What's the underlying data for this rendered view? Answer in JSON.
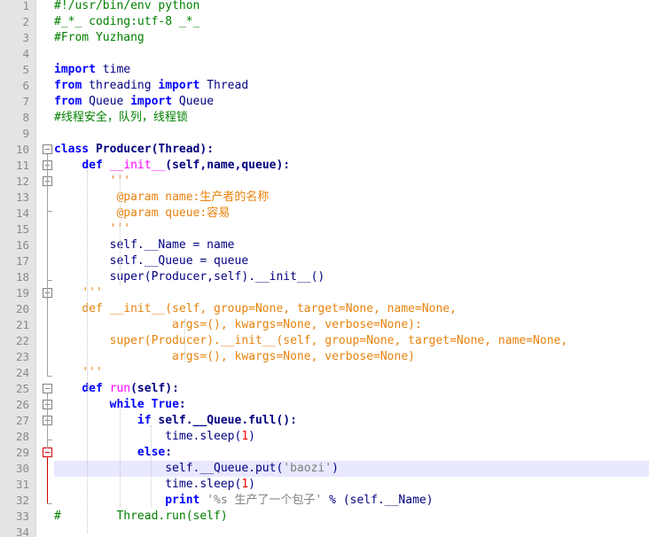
{
  "lines": [
    {
      "n": "1",
      "segs": [
        [
          "c",
          "#!/usr/bin/env python"
        ]
      ]
    },
    {
      "n": "2",
      "segs": [
        [
          "c",
          "#_*_ coding:utf-8 _*_"
        ]
      ]
    },
    {
      "n": "3",
      "segs": [
        [
          "c",
          "#From Yuzhang"
        ]
      ]
    },
    {
      "n": "4",
      "segs": []
    },
    {
      "n": "5",
      "segs": [
        [
          "k",
          "import"
        ],
        [
          "t",
          " time"
        ]
      ]
    },
    {
      "n": "6",
      "segs": [
        [
          "k",
          "from"
        ],
        [
          "t",
          " threading "
        ],
        [
          "k",
          "import"
        ],
        [
          "t",
          " Thread"
        ]
      ]
    },
    {
      "n": "7",
      "segs": [
        [
          "k",
          "from"
        ],
        [
          "t",
          " Queue "
        ],
        [
          "k",
          "import"
        ],
        [
          "t",
          " Queue"
        ]
      ]
    },
    {
      "n": "8",
      "segs": [
        [
          "c",
          "#线程安全，队列，线程锁"
        ]
      ]
    },
    {
      "n": "9",
      "segs": []
    },
    {
      "n": "10",
      "segs": [
        [
          "k",
          "class"
        ],
        [
          "b",
          " Producer"
        ],
        [
          "b",
          "(Thread):"
        ]
      ]
    },
    {
      "n": "11",
      "segs": [
        [
          "t",
          "    "
        ],
        [
          "k",
          "def"
        ],
        [
          "t",
          " "
        ],
        [
          "fn",
          "__init__"
        ],
        [
          "b",
          "(self,name,queue):"
        ]
      ]
    },
    {
      "n": "12",
      "segs": [
        [
          "t",
          "        "
        ],
        [
          "doc",
          "'''"
        ]
      ]
    },
    {
      "n": "13",
      "segs": [
        [
          "t",
          "        "
        ],
        [
          "doc",
          " @param name:生产者的名称"
        ]
      ]
    },
    {
      "n": "14",
      "segs": [
        [
          "t",
          "        "
        ],
        [
          "doc",
          " @param queue:容易"
        ]
      ]
    },
    {
      "n": "15",
      "segs": [
        [
          "t",
          "        "
        ],
        [
          "doc",
          "'''"
        ]
      ]
    },
    {
      "n": "16",
      "segs": [
        [
          "t",
          "        self.__Name = name"
        ]
      ]
    },
    {
      "n": "17",
      "segs": [
        [
          "t",
          "        self.__Queue = queue"
        ]
      ]
    },
    {
      "n": "18",
      "segs": [
        [
          "t",
          "        super(Producer,self).__init__()"
        ]
      ]
    },
    {
      "n": "19",
      "segs": [
        [
          "t",
          "    "
        ],
        [
          "doc",
          "'''"
        ]
      ]
    },
    {
      "n": "20",
      "segs": [
        [
          "t",
          "    "
        ],
        [
          "doc",
          "def __init__(self, group=None, target=None, name=None,"
        ]
      ]
    },
    {
      "n": "21",
      "segs": [
        [
          "t",
          "    "
        ],
        [
          "doc",
          "             args=(), kwargs=None, verbose=None):"
        ]
      ]
    },
    {
      "n": "22",
      "segs": [
        [
          "t",
          "    "
        ],
        [
          "doc",
          "    super(Producer).__init__(self, group=None, target=None, name=None,"
        ]
      ]
    },
    {
      "n": "23",
      "segs": [
        [
          "t",
          "    "
        ],
        [
          "doc",
          "             args=(), kwargs=None, verbose=None)"
        ]
      ]
    },
    {
      "n": "24",
      "segs": [
        [
          "t",
          "    "
        ],
        [
          "doc",
          "'''"
        ]
      ]
    },
    {
      "n": "25",
      "segs": [
        [
          "t",
          "    "
        ],
        [
          "k",
          "def"
        ],
        [
          "t",
          " "
        ],
        [
          "fn",
          "run"
        ],
        [
          "b",
          "(self):"
        ]
      ]
    },
    {
      "n": "26",
      "segs": [
        [
          "t",
          "        "
        ],
        [
          "k",
          "while True"
        ],
        [
          "b",
          ":"
        ]
      ]
    },
    {
      "n": "27",
      "segs": [
        [
          "t",
          "            "
        ],
        [
          "k",
          "if"
        ],
        [
          "b",
          " self.__Queue.full():"
        ]
      ]
    },
    {
      "n": "28",
      "segs": [
        [
          "t",
          "                time.sleep("
        ],
        [
          "n",
          "1"
        ],
        [
          "t",
          ")"
        ]
      ]
    },
    {
      "n": "29",
      "segs": [
        [
          "t",
          "            "
        ],
        [
          "k",
          "else"
        ],
        [
          "b",
          ":"
        ]
      ]
    },
    {
      "n": "30",
      "segs": [
        [
          "t",
          "                self.__Queue.put("
        ],
        [
          "s",
          "'baozi'"
        ],
        [
          "t",
          ")"
        ]
      ]
    },
    {
      "n": "31",
      "segs": [
        [
          "t",
          "                time.sleep("
        ],
        [
          "n",
          "1"
        ],
        [
          "t",
          ")"
        ]
      ]
    },
    {
      "n": "32",
      "segs": [
        [
          "t",
          "                "
        ],
        [
          "k",
          "print"
        ],
        [
          "t",
          " "
        ],
        [
          "s",
          "'%s 生产了一个包子'"
        ],
        [
          "t",
          " % (self.__Name)"
        ]
      ]
    },
    {
      "n": "33",
      "segs": [
        [
          "c",
          "#        Thread.run(self)"
        ]
      ]
    },
    {
      "n": "34",
      "segs": []
    }
  ],
  "highlighted_line": "30",
  "colors": {
    "keyword": "#0000ff",
    "comment": "#008000",
    "docstring": "#e8820c",
    "number": "#ff0000",
    "highlight": "#e8e8ff",
    "gutter": "#e4e4e4"
  }
}
